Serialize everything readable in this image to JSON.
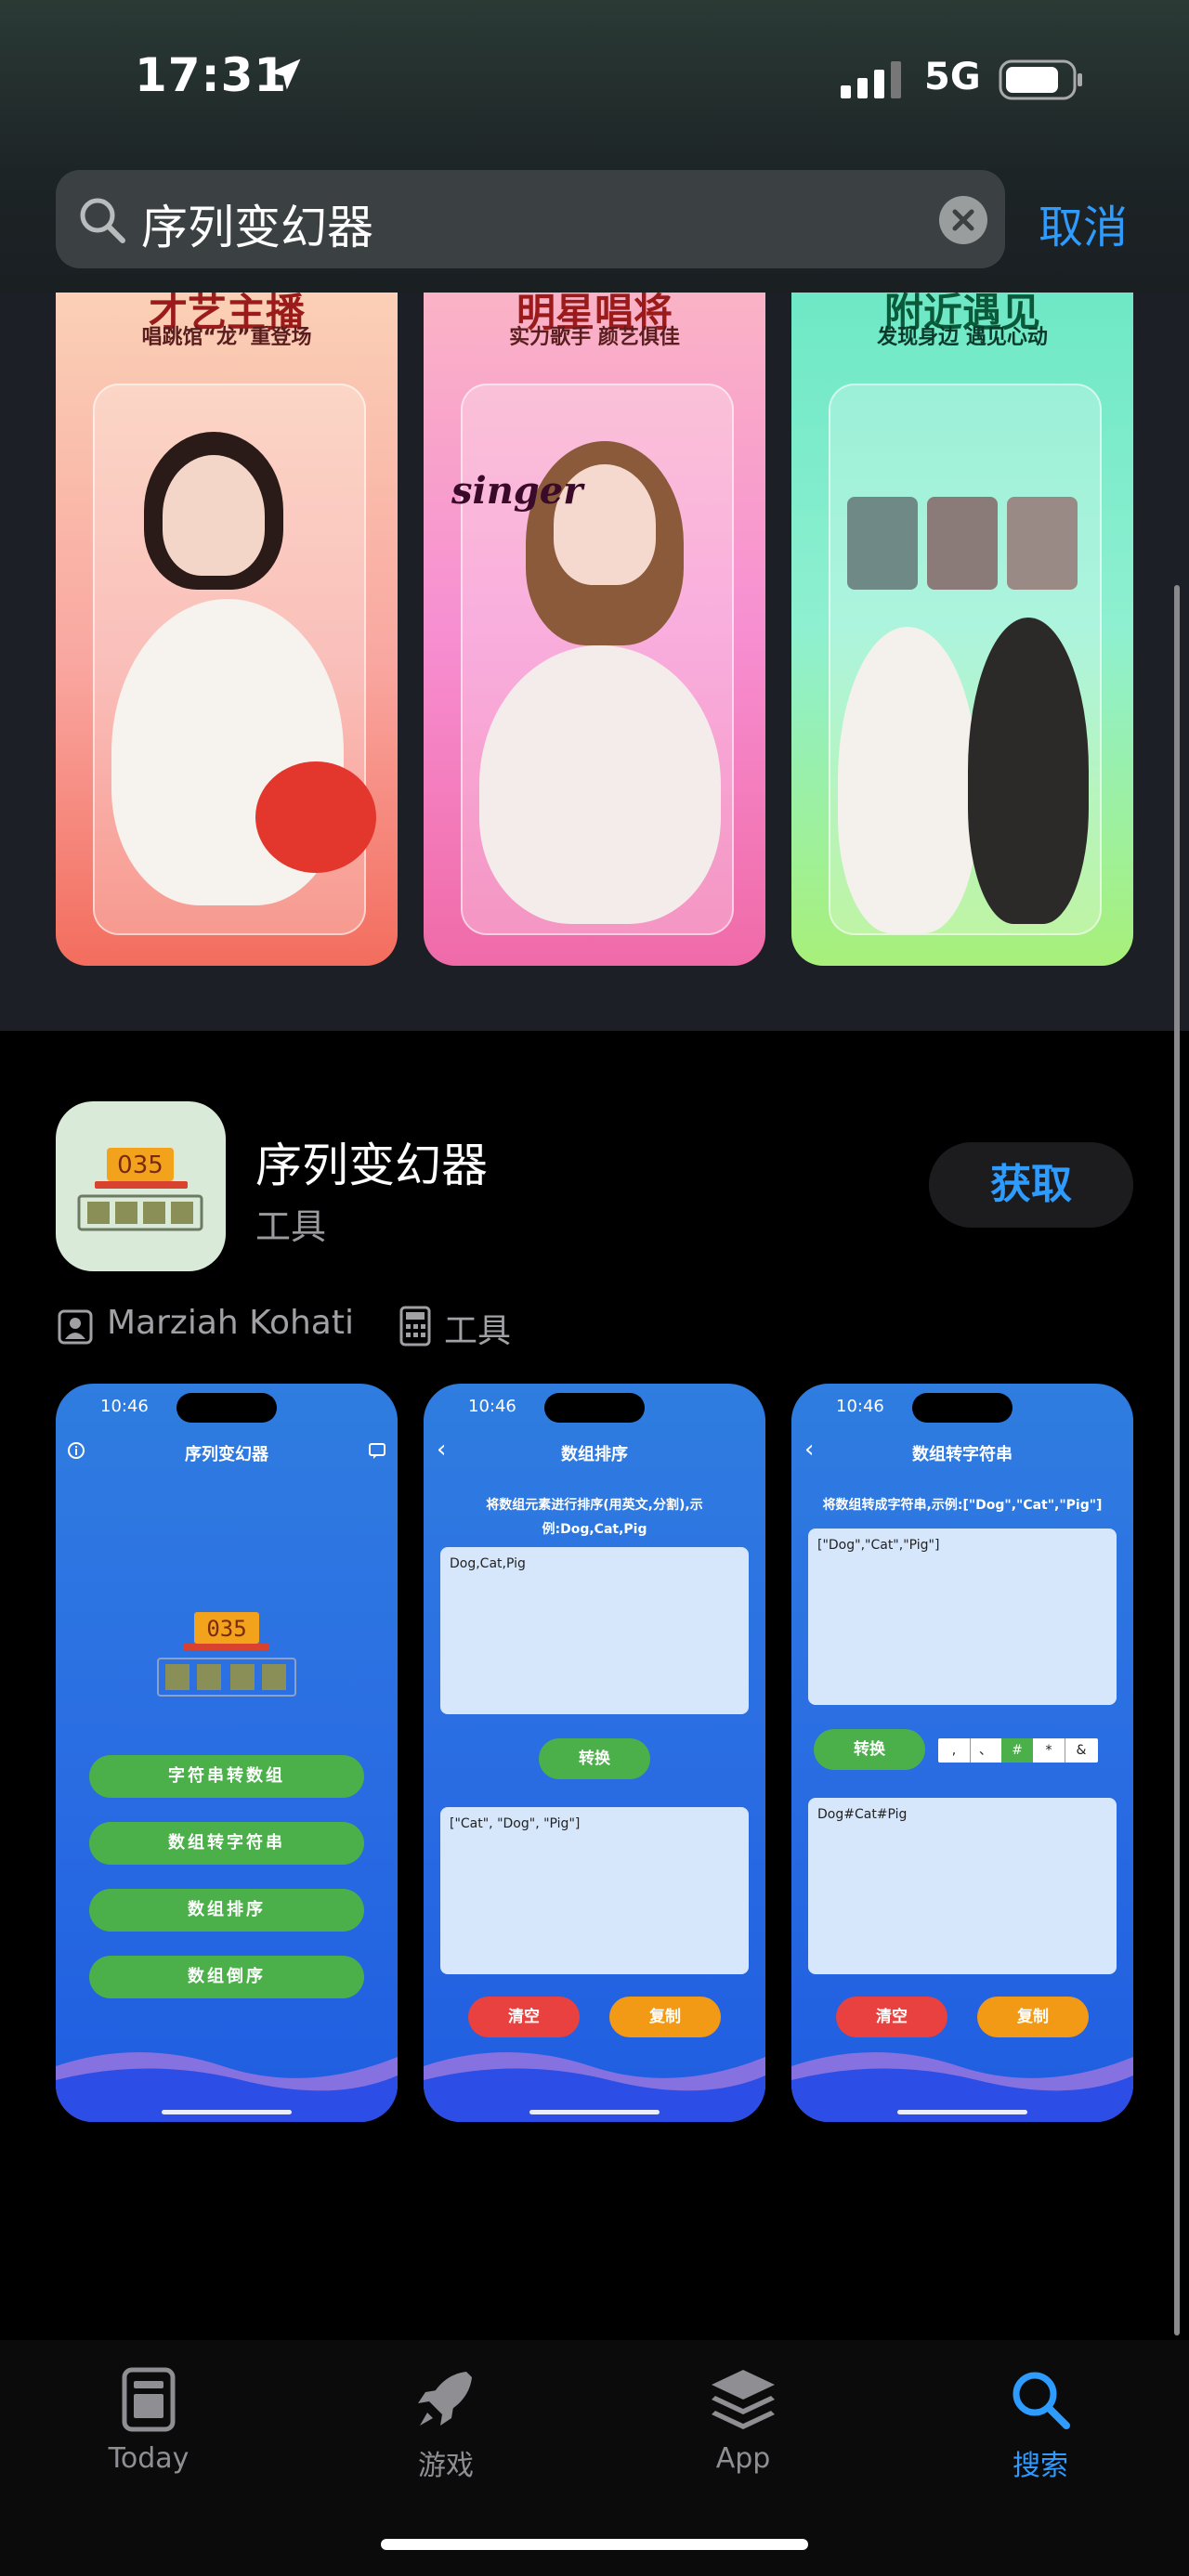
{
  "status": {
    "time": "17:31",
    "network": "5G"
  },
  "search": {
    "query": "序列变幻器",
    "cancel_label": "取消"
  },
  "promo_shots": [
    {
      "title": "才艺主播",
      "subtitle": "唱跳馆“龙”重登场"
    },
    {
      "title": "明星唱将",
      "subtitle": "实力歌手 颜艺俱佳",
      "overlay": "singer"
    },
    {
      "title": "附近遇见",
      "subtitle": "发现身边 遇见心动"
    }
  ],
  "app": {
    "name": "序列变幻器",
    "category": "工具",
    "icon_counter": "035",
    "get_label": "获取",
    "developer": "Marziah Kohati",
    "genre": "工具"
  },
  "device_shots": [
    {
      "time": "10:46",
      "title": "序列变幻器",
      "counter": "035",
      "buttons": [
        "字符串转数组",
        "数组转字符串",
        "数组排序",
        "数组倒序"
      ]
    },
    {
      "time": "10:46",
      "title": "数组排序",
      "hint": "将数组元素进行排序(用英文,分割),示例:Dog,Cat,Pig",
      "input": "Dog,Cat,Pig",
      "convert_label": "转换",
      "output": "[\"Cat\", \"Dog\", \"Pig\"]",
      "clear_label": "清空",
      "copy_label": "复制"
    },
    {
      "time": "10:46",
      "title": "数组转字符串",
      "hint": "将数组转成字符串,示例:[\"Dog\",\"Cat\",\"Pig\"]",
      "input": "[\"Dog\",\"Cat\",\"Pig\"]",
      "convert_label": "转换",
      "separators": [
        ",",
        "、",
        "#",
        "*",
        "&"
      ],
      "output": "Dog#Cat#Pig",
      "clear_label": "清空",
      "copy_label": "复制"
    }
  ],
  "tabs": [
    {
      "label": "Today",
      "icon": "today-icon"
    },
    {
      "label": "游戏",
      "icon": "rocket-icon"
    },
    {
      "label": "App",
      "icon": "layers-icon"
    },
    {
      "label": "搜索",
      "icon": "search-icon",
      "active": true
    }
  ],
  "colors": {
    "accent": "#2e9bff",
    "green_button": "#4bb04a",
    "red_button": "#e8413f",
    "orange_button": "#f29a16"
  }
}
